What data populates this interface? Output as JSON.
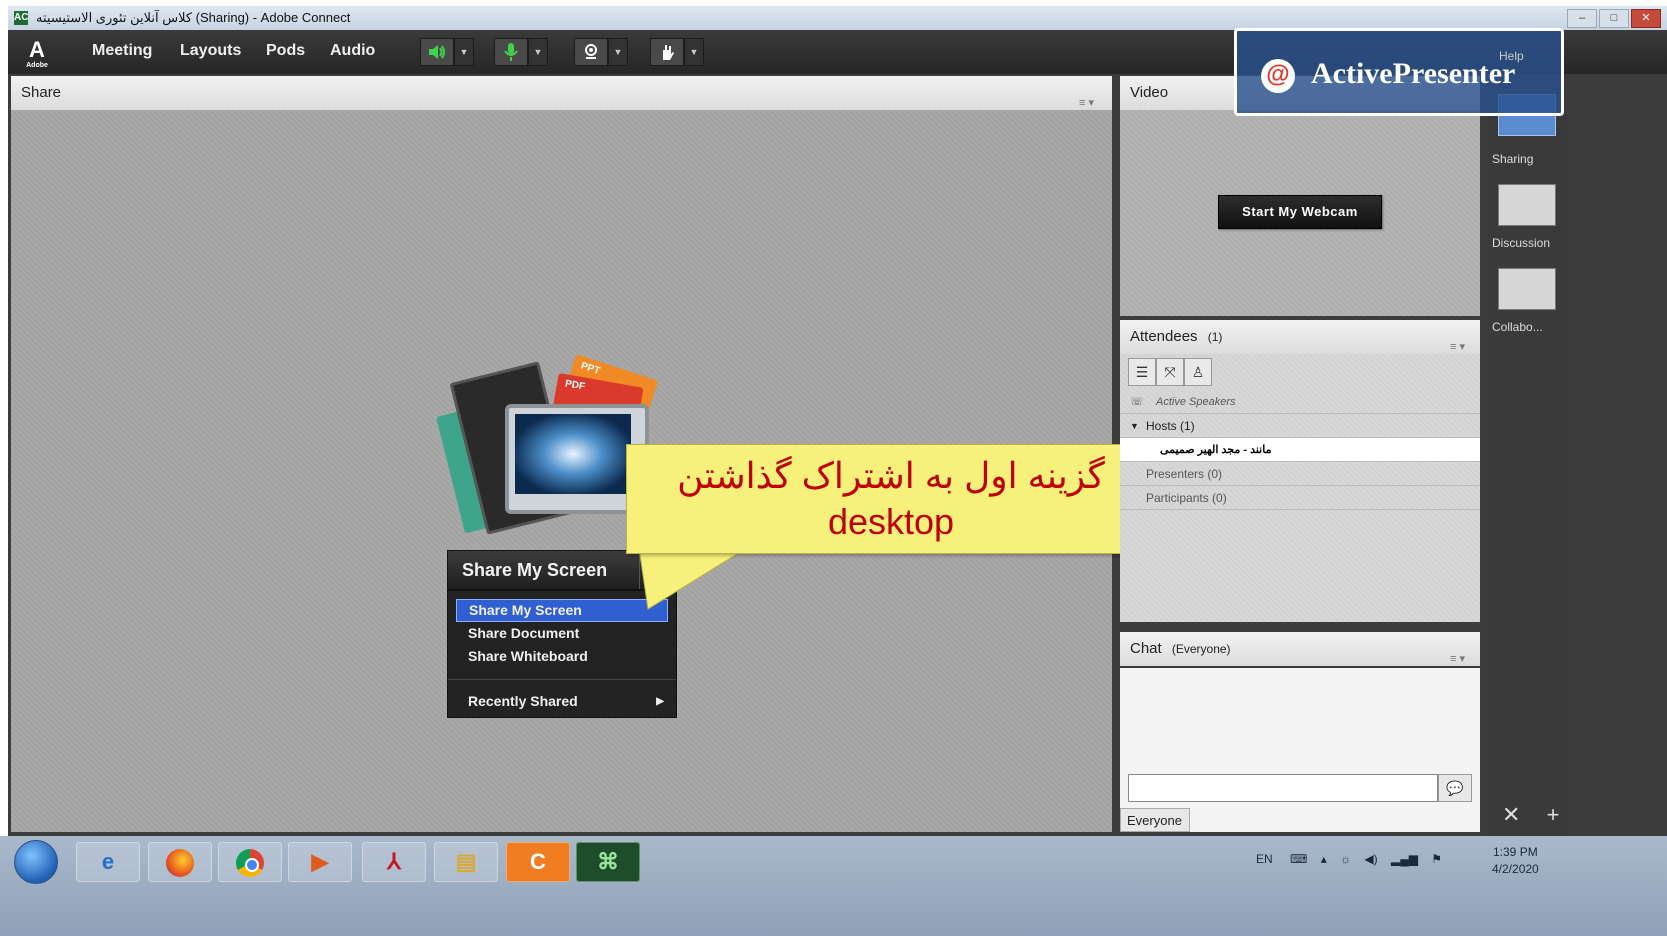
{
  "window": {
    "title": "کلاس آنلاین تئوری الاستیسیته (Sharing) - Adobe Connect",
    "app_icon": "AC",
    "controls": [
      "–",
      "□",
      "✕"
    ]
  },
  "menubar": {
    "logo_mark": "A",
    "logo_text": "Adobe",
    "items": [
      "Meeting",
      "Layouts",
      "Pods",
      "Audio"
    ],
    "toolbar_icons": [
      "speaker-icon",
      "microphone-icon",
      "webcam-icon",
      "raise-hand-icon"
    ]
  },
  "share_pod": {
    "title": "Share",
    "menu_glyph": "≡ ▾",
    "button_label": "Share My Screen",
    "menu_items": [
      "Share My Screen",
      "Share Document",
      "Share Whiteboard"
    ],
    "selected_item": "Share My Screen",
    "recently_shared": "Recently Shared",
    "file_badges": [
      "PPT",
      "PDF"
    ]
  },
  "callout": {
    "line1": "گزینه اول به اشتراک گذاشتن",
    "line2": "desktop",
    "color": "#f7f07a",
    "text_color": "#c00000"
  },
  "video_pod": {
    "title": "Video",
    "button_label": "Start My Webcam"
  },
  "attendees_pod": {
    "title": "Attendees",
    "count": "(1)",
    "active_speakers": "Active Speakers",
    "hosts": "Hosts (1)",
    "host_name": "مانند - مجد الهیر صمیمی",
    "presenters": "Presenters (0)",
    "participants": "Participants (0)"
  },
  "chat_pod": {
    "title": "Chat",
    "scope": "(Everyone)",
    "input_value": "",
    "tab_label": "Everyone"
  },
  "layouts_bar": {
    "items": [
      "Sharing",
      "Discussion",
      "Collabo..."
    ],
    "selected": "Sharing"
  },
  "watermark": {
    "text": "ActivePresenter",
    "help": "Help"
  },
  "taskbar": {
    "apps": [
      "start-button",
      "internet-explorer-icon",
      "firefox-icon",
      "chrome-icon",
      "media-player-icon",
      "acrobat-icon",
      "file-explorer-icon",
      "activepresenter-icon",
      "adobe-connect-icon"
    ],
    "tray_lang": "EN",
    "time": "1:39 PM",
    "date": "4/2/2020"
  }
}
